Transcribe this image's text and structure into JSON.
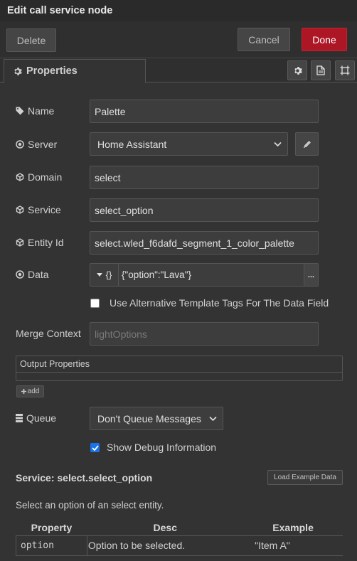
{
  "window": {
    "title": "Edit call service node"
  },
  "toolbar": {
    "delete_label": "Delete",
    "cancel_label": "Cancel",
    "done_label": "Done"
  },
  "tabs": {
    "properties_label": "Properties"
  },
  "form": {
    "name": {
      "label": "Name",
      "value": "Palette"
    },
    "server": {
      "label": "Server",
      "value": "Home Assistant"
    },
    "domain": {
      "label": "Domain",
      "value": "select"
    },
    "service": {
      "label": "Service",
      "value": "select_option"
    },
    "entity": {
      "label": "Entity Id",
      "value": "select.wled_f6dafd_segment_1_color_palette"
    },
    "data": {
      "label": "Data",
      "type_symbol": "{}",
      "value": "{\"option\":\"Lava\"}",
      "more": "..."
    },
    "alt_template": {
      "label": "Use Alternative Template Tags For The Data Field",
      "checked": false
    },
    "merge_context": {
      "label": "Merge Context",
      "placeholder": "lightOptions"
    },
    "output": {
      "header": "Output Properties",
      "add_label": "add"
    },
    "queue": {
      "label": "Queue",
      "value": "Don't Queue Messages"
    },
    "debug": {
      "label": "Show Debug Information",
      "checked": true
    }
  },
  "service_info": {
    "title": "Service: select.select_option",
    "load_button": "Load Example Data",
    "description": "Select an option of an select entity.",
    "table": {
      "headers": [
        "Property",
        "Desc",
        "Example"
      ],
      "rows": [
        {
          "property": "option",
          "desc": "Option to be selected.",
          "example": "\"Item A\""
        }
      ]
    }
  },
  "colors": {
    "accent_done": "#ad1625",
    "code_text": "#e3a72f",
    "checkbox": "#1a73e8"
  }
}
